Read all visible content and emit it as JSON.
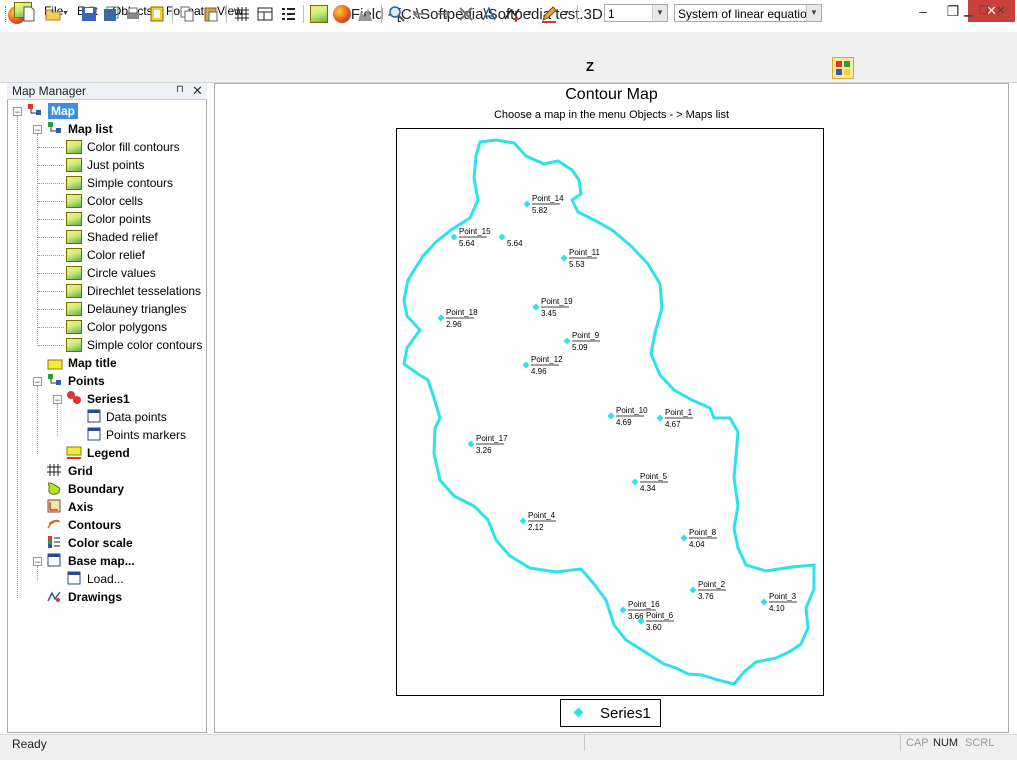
{
  "window": {
    "title": "Field - [C:\\Softpedia\\Softpedia test.3DF - Maps]",
    "min_glyph": "–",
    "max_glyph": "❐",
    "close_glyph": "✕"
  },
  "menu": {
    "items": [
      "File",
      "Edit",
      "Objects",
      "Format",
      "View"
    ],
    "mdi_min": "▁",
    "mdi_restore": "❐",
    "mdi_close": "✕"
  },
  "toolbar": {
    "z_label": "Z",
    "z_value": "1",
    "method_value": "System of linear equatio",
    "combo_arrow": "▼"
  },
  "panel": {
    "title": "Map Manager",
    "pin": "⊓",
    "close": "✕",
    "tree": {
      "root": "Map",
      "map_list": "Map list",
      "maps": [
        "Color fill contours",
        "Just points",
        "Simple contours",
        "Color cells",
        "Color points",
        "Shaded relief",
        "Color relief",
        "Circle values",
        "Direchlet tesselations",
        "Delauney triangles",
        "Color polygons",
        "Simple color contours"
      ],
      "map_title": "Map title",
      "points": "Points",
      "series1": "Series1",
      "data_points": "Data points",
      "points_markers": "Points markers",
      "legend": "Legend",
      "grid": "Grid",
      "boundary": "Boundary",
      "axis": "Axis",
      "contours": "Contours",
      "color_scale": "Color scale",
      "base_map": "Base map...",
      "load": "Load...",
      "drawings": "Drawings",
      "minus": "−"
    }
  },
  "map": {
    "title": "Contour Map",
    "subtitle": "Choose a map in the menu Objects - > Maps list",
    "legend_series": "Series1",
    "boundary_color": "#2de2ec",
    "marker_color": "#2de2ec",
    "points": [
      {
        "name": "Point_14",
        "value": "5.82"
      },
      {
        "name": "Point_15",
        "value": "5.64"
      },
      {
        "name": "",
        "value": "5.64"
      },
      {
        "name": "Point_11",
        "value": "5.53"
      },
      {
        "name": "Point_19",
        "value": "3.45"
      },
      {
        "name": "Point_18",
        "value": "2.96"
      },
      {
        "name": "Point_9",
        "value": "5.09"
      },
      {
        "name": "Point_12",
        "value": "4.96"
      },
      {
        "name": "Point_10",
        "value": "4.69"
      },
      {
        "name": "Point_1",
        "value": "4.67"
      },
      {
        "name": "Point_17",
        "value": "3.26"
      },
      {
        "name": "Point_5",
        "value": "4.34"
      },
      {
        "name": "Point_4",
        "value": "2.12"
      },
      {
        "name": "Point_8",
        "value": "4.04"
      },
      {
        "name": "Point_2",
        "value": "3.76"
      },
      {
        "name": "Point_3",
        "value": "4.10"
      },
      {
        "name": "Point_16",
        "value": "3.66"
      },
      {
        "name": "Point_6",
        "value": "3.60"
      }
    ]
  },
  "status": {
    "text": "Ready",
    "cap": "CAP",
    "num": "NUM",
    "scrl": "SCRL"
  }
}
